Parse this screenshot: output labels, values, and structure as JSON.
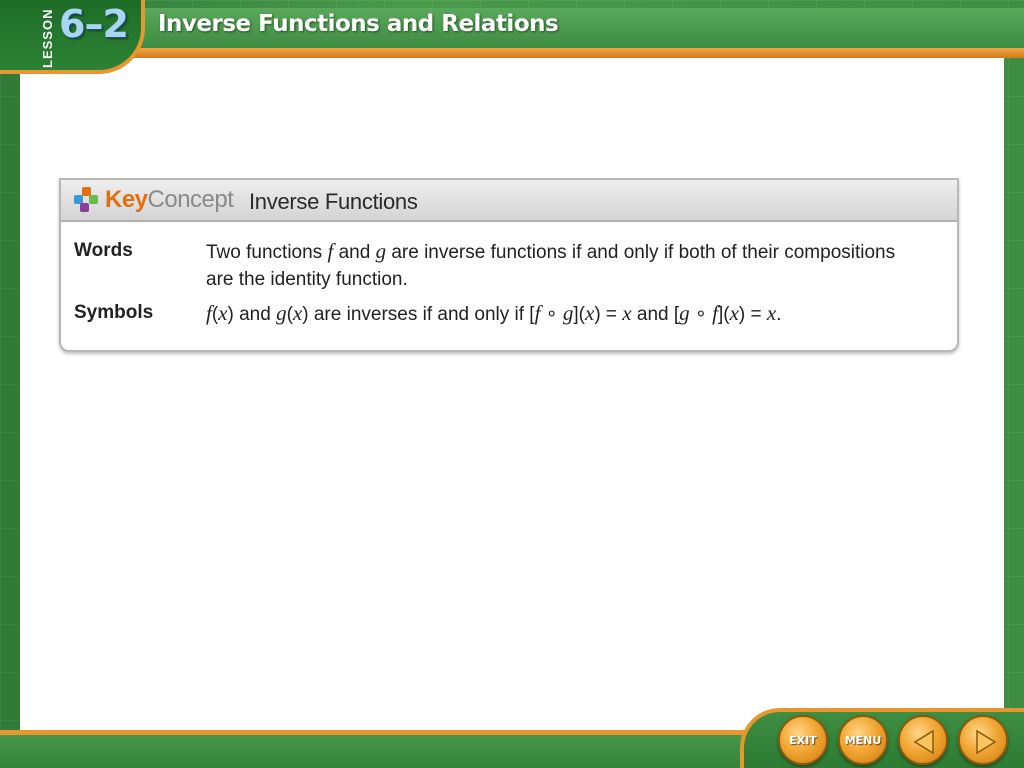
{
  "header": {
    "lesson_word": "LESSON",
    "lesson_number": "6–2",
    "title": "Inverse Functions and Relations"
  },
  "key_concept": {
    "brand_key": "Key",
    "brand_concept": "Concept",
    "title": "Inverse Functions",
    "rows": [
      {
        "label": "Words",
        "text_parts": [
          "Two functions ",
          "f",
          " and ",
          "g",
          " are inverse functions if and only if both of their compositions are the identity function."
        ]
      },
      {
        "label": "Symbols",
        "text_parts": [
          "f",
          "(",
          "x",
          ") and ",
          "g",
          "(",
          "x",
          ") are inverses if and only if [",
          "f",
          " ∘ ",
          "g",
          "](",
          "x",
          ") = ",
          "x",
          " and [",
          "g",
          " ∘ ",
          "f",
          "](",
          "x",
          ") = ",
          "x",
          "."
        ]
      }
    ]
  },
  "navigation": {
    "exit_label": "EXIT",
    "menu_label": "MENU",
    "prev_icon": "left-arrow-icon",
    "next_icon": "right-arrow-icon"
  },
  "colors": {
    "frame_green": "#3f8f45",
    "accent_orange": "#e8962e",
    "key_orange": "#e46f12",
    "number_blue": "#a9d5f0"
  }
}
